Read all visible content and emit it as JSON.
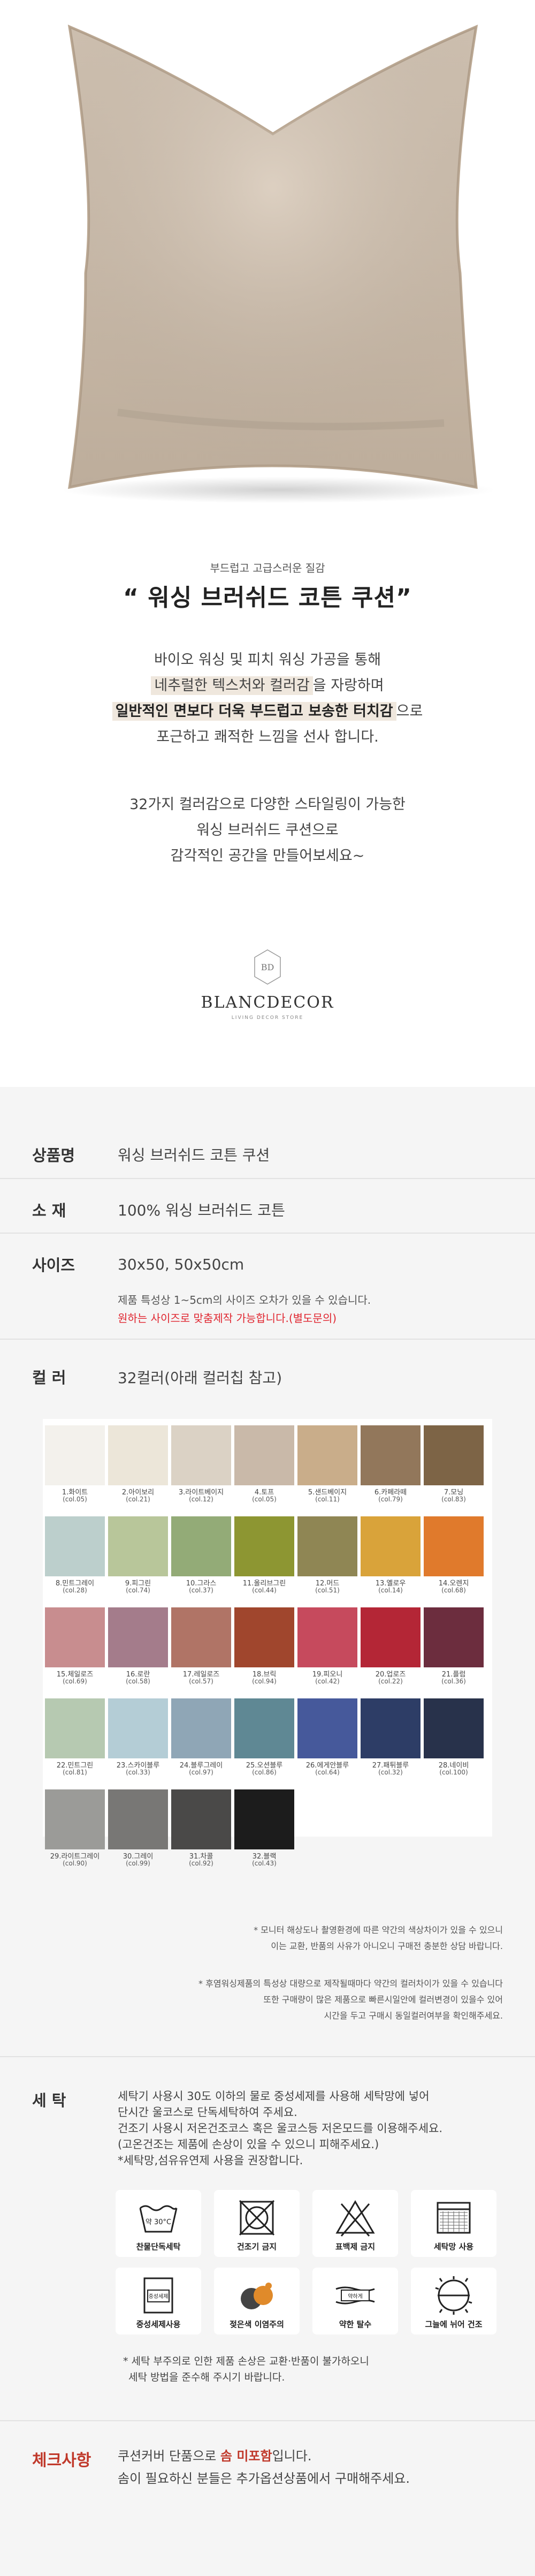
{
  "intro": {
    "subtitle": "부드럽고 고급스러운 질감",
    "title": "“ 워싱 브러쉬드 코튼 쿠션”",
    "line1": "바이오 워싱 및 피치 워싱 가공을 통해",
    "line2_hl": "네추럴한 텍스처와 컬러감",
    "line2_rest": "을 자랑하며",
    "line3_hl": "일반적인 면보다 더욱 부드럽고 보송한 터치감",
    "line3_rest": "으로",
    "line4": "포근하고 쾌적한 느낌을 선사 합니다.",
    "line5": "32가지 컬러감으로 다양한 스타일링이 가능한",
    "line6": "워싱 브러쉬드 쿠션으로",
    "line7": "감각적인 공간을 만들어보세요~"
  },
  "logo": {
    "mark": "BD",
    "name": "BLANCDECOR",
    "tagline": "LIVING DECOR STORE"
  },
  "product": {
    "name_label": "상품명",
    "name_value": "워싱 브러쉬드 코튼 쿠션",
    "material_label": "소    재",
    "material_value": "100% 워싱 브러쉬드 코튼",
    "size_label": "사이즈",
    "size_value": "30x50, 50x50cm",
    "size_note1": "제품 특성상 1~5cm의 사이즈 오차가 있을 수 있습니다.",
    "size_note2": "원하는 사이즈로 맞춤제작 가능합니다.(별도문의)",
    "color_label": "컬    러",
    "color_value": "32컬러(아래 컬러칩 참고)"
  },
  "swatches": [
    {
      "name": "1.화이트",
      "code": "(col.05)",
      "color": "#f3f1ec"
    },
    {
      "name": "2.아이보리",
      "code": "(col.21)",
      "color": "#ece6d9"
    },
    {
      "name": "3.라이트베이지",
      "code": "(col.12)",
      "color": "#dbd2c5"
    },
    {
      "name": "4.토프",
      "code": "(col.05)",
      "color": "#c9b9a9"
    },
    {
      "name": "5.샌드베이지",
      "code": "(col.11)",
      "color": "#c9ad8a"
    },
    {
      "name": "6.카페라떼",
      "code": "(col.79)",
      "color": "#92775b"
    },
    {
      "name": "7.모닝",
      "code": "(col.83)",
      "color": "#7d6446"
    },
    {
      "name": "8.민트그레이",
      "code": "(col.28)",
      "color": "#bccfcc"
    },
    {
      "name": "9.피그린",
      "code": "(col.74)",
      "color": "#b8c69a"
    },
    {
      "name": "10.그라스",
      "code": "(col.37)",
      "color": "#93ab77"
    },
    {
      "name": "11.올리브그린",
      "code": "(col.44)",
      "color": "#8d9632"
    },
    {
      "name": "12.머드",
      "code": "(col.51)",
      "color": "#8f8654"
    },
    {
      "name": "13.옐로우",
      "code": "(col.14)",
      "color": "#d9a33a"
    },
    {
      "name": "14.오렌지",
      "code": "(col.68)",
      "color": "#e07a2c"
    },
    {
      "name": "15.체일로즈",
      "code": "(col.69)",
      "color": "#c88d8f"
    },
    {
      "name": "16.로란",
      "code": "(col.58)",
      "color": "#a47c8b"
    },
    {
      "name": "17.레일로즈",
      "code": "(col.57)",
      "color": "#b07466"
    },
    {
      "name": "18.브릭",
      "code": "(col.94)",
      "color": "#a0462d"
    },
    {
      "name": "19.피오니",
      "code": "(col.42)",
      "color": "#c64a5d"
    },
    {
      "name": "20.업로즈",
      "code": "(col.22)",
      "color": "#b42636"
    },
    {
      "name": "21.플럼",
      "code": "(col.36)",
      "color": "#6c2d3e"
    },
    {
      "name": "22.민트그린",
      "code": "(col.81)",
      "color": "#b6c9b1"
    },
    {
      "name": "23.스카이블루",
      "code": "(col.33)",
      "color": "#b4cdd6"
    },
    {
      "name": "24.블루그레이",
      "code": "(col.97)",
      "color": "#8fa6b6"
    },
    {
      "name": "25.오션블루",
      "code": "(col.86)",
      "color": "#5f8894"
    },
    {
      "name": "26.에게안블루",
      "code": "(col.64)",
      "color": "#46599b"
    },
    {
      "name": "27.패튀블루",
      "code": "(col.32)",
      "color": "#2d3d66"
    },
    {
      "name": "28.네이비",
      "code": "(col.100)",
      "color": "#28324b"
    },
    {
      "name": "29.라이트그레이",
      "code": "(col.90)",
      "color": "#9b9b98"
    },
    {
      "name": "30.그레이",
      "code": "(col.99)",
      "color": "#787775"
    },
    {
      "name": "31.차콜",
      "code": "(col.92)",
      "color": "#4a4948"
    },
    {
      "name": "32.블랙",
      "code": "(col.43)",
      "color": "#1c1c1c"
    }
  ],
  "color_notes": {
    "n1": "* 모니터 해상도나 촬영환경에 따른 약간의 색상차이가 있을 수 있으니",
    "n2": "이는 교환, 반품의 사유가 아니오니 구매전 충분한 상담 바랍니다.",
    "n3": "* 후염워싱제품의 특성상 대량으로 제작될때마다 약간의 컬러차이가 있을 수 있습니다",
    "n4": "또한 구매량이 많은 제품으로 빠른시일안에 컬러변경이 있을수 있어",
    "n5": "시간을 두고 구매시 동일컬러여부을 확인해주세요."
  },
  "wash": {
    "label": "세    탁",
    "t1": "세탁기 사용시 30도 이하의 물로 중성세제를 사용해 세탁망에 넣어",
    "t2": "단시간 울코스로 단독세탁하여 주세요.",
    "t3": "건조기 사용시 저온건조코스 혹은 울코스등 저온모드를 이용해주세요.",
    "t4": "(고온건조는 제품에 손상이 있을 수 있으니 피해주세요.)",
    "t5": "*세탁망,섬유유연제 사용을 권장합니다.",
    "icons": [
      {
        "label": "찬물단독세탁",
        "temp": "약 30°C"
      },
      {
        "label": "건조기 금지"
      },
      {
        "label": "표백제 금지"
      },
      {
        "label": "세탁망 사용"
      },
      {
        "label": "중성세제사용",
        "box": "중성세제"
      },
      {
        "label": "젖은색 이염주의"
      },
      {
        "label": "약한 탈수",
        "box": "약하게"
      },
      {
        "label": "그늘에 뉘어 건조"
      }
    ],
    "b1": "* 세탁 부주의로 인한 제품 손상은 교환·반품이 불가하오니",
    "b2": "세탁 방법을 준수해 주시기 바랍니다."
  },
  "check": {
    "label": "체크사항",
    "line1_a": "쿠션커버 단품으로 ",
    "line1_b": "솜 미포함",
    "line1_c": "입니다.",
    "line2": "솜이 필요하신 분들은 추가옵션상품에서 구매해주세요."
  },
  "colors": {
    "pillow": "#d3c3b1",
    "highlight": "#efe7dd",
    "red_note": "#e0252f",
    "check": "#c0392b"
  }
}
